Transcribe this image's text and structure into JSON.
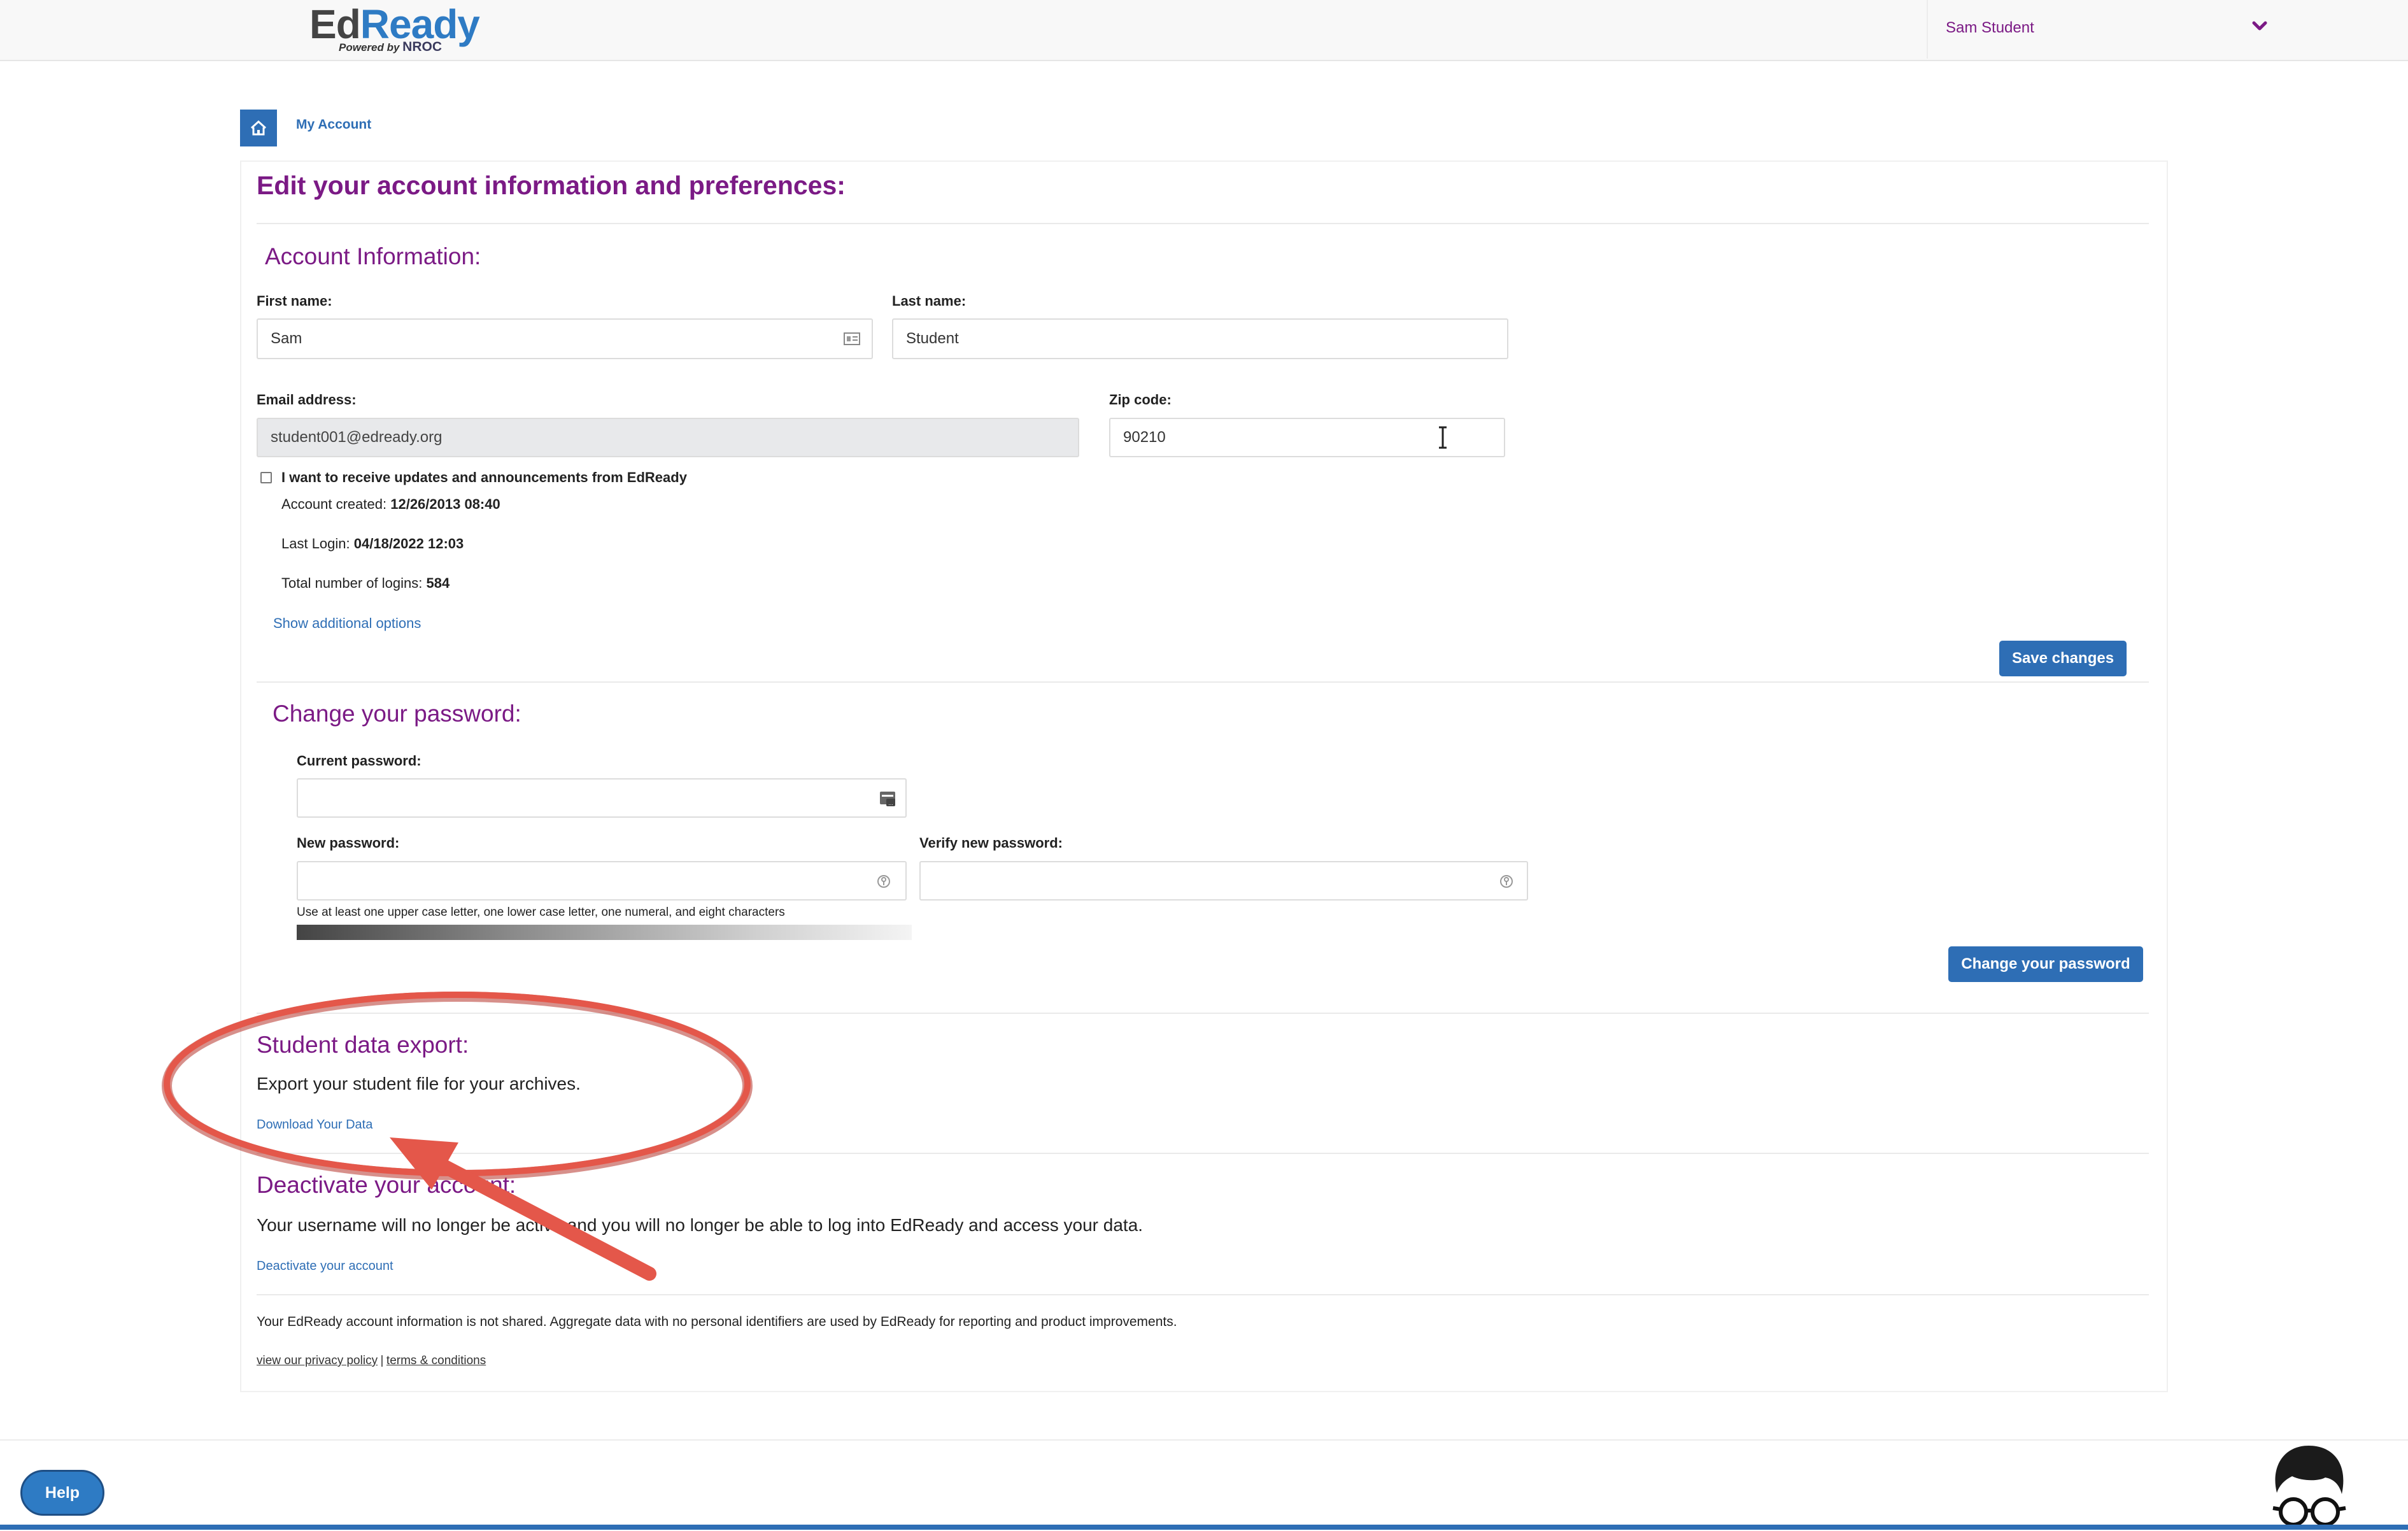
{
  "header": {
    "logo_ed": "Ed",
    "logo_ready": "Ready",
    "logo_powered": "Powered by",
    "logo_nroc": "NROC",
    "user_name": "Sam Student"
  },
  "breadcrumb": {
    "current": "My Account"
  },
  "page": {
    "title": "Edit your account information and preferences:"
  },
  "account": {
    "heading": "Account Information:",
    "first_name_label": "First name:",
    "first_name_value": "Sam",
    "last_name_label": "Last name:",
    "last_name_value": "Student",
    "email_label": "Email address:",
    "email_value": "student001@edready.org",
    "zip_label": "Zip code:",
    "zip_value": "90210",
    "updates_checkbox_label": "I want to receive updates and announcements from EdReady",
    "updates_checked": false,
    "created_label": "Account created:",
    "created_value": "12/26/2013 08:40",
    "last_login_label": "Last Login:",
    "last_login_value": "04/18/2022 12:03",
    "logins_label": "Total number of logins:",
    "logins_value": "584",
    "additional_options_link": "Show additional options",
    "save_button": "Save changes"
  },
  "password": {
    "heading": "Change your password:",
    "current_label": "Current password:",
    "new_label": "New password:",
    "verify_label": "Verify new password:",
    "hint": "Use at least one upper case letter, one lower case letter, one numeral, and eight characters",
    "change_button": "Change your password"
  },
  "export": {
    "heading": "Student data export:",
    "description": "Export your student file for your archives.",
    "download_link": "Download Your Data"
  },
  "deactivate": {
    "heading": "Deactivate your account:",
    "description": "Your username will no longer be active and you will no longer be able to log into EdReady and access your data.",
    "link": "Deactivate your account"
  },
  "privacy": {
    "notice": "Your EdReady account information is not shared. Aggregate data with no personal identifiers are used by EdReady for reporting and product improvements.",
    "privacy_link": "view our privacy policy",
    "separator": "|",
    "terms_link": "terms & conditions"
  },
  "footer": {
    "help_button": "Help"
  },
  "colors": {
    "accent_purple": "#7b1a85",
    "brand_blue": "#2e6eb5",
    "annotation_red": "#e4574a"
  }
}
